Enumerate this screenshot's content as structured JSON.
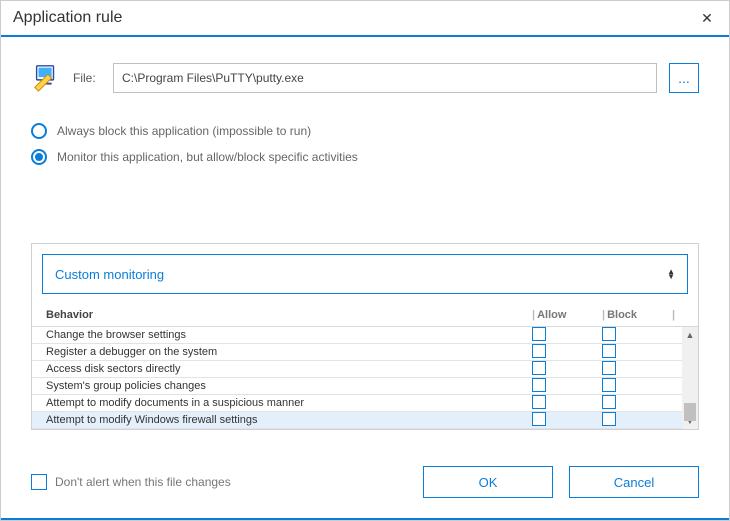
{
  "window": {
    "title": "Application rule"
  },
  "file": {
    "label": "File:",
    "path": "C:\\Program Files\\PuTTY\\putty.exe",
    "browse": "..."
  },
  "mode": {
    "block_label": "Always block this application (impossible to run)",
    "monitor_label": "Monitor this application, but allow/block specific activities",
    "selected": "monitor"
  },
  "monitoring": {
    "dropdown_label": "Custom monitoring",
    "columns": {
      "behavior": "Behavior",
      "allow": "Allow",
      "block": "Block"
    },
    "rows": [
      {
        "label": "Change the browser settings"
      },
      {
        "label": "Register a debugger on the system"
      },
      {
        "label": "Access disk sectors directly"
      },
      {
        "label": "System's group policies changes"
      },
      {
        "label": "Attempt to modify documents in a suspicious manner"
      },
      {
        "label": "Attempt to modify Windows firewall settings"
      }
    ]
  },
  "footer": {
    "alert_label": "Don't alert when this file changes",
    "ok": "OK",
    "cancel": "Cancel"
  }
}
